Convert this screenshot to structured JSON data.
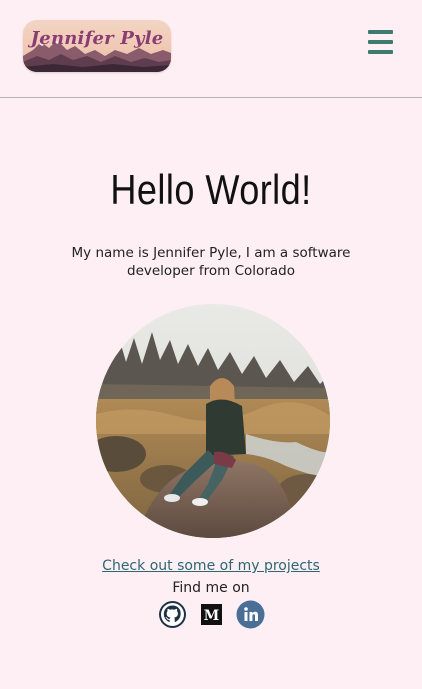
{
  "header": {
    "logo_text": "Jennifer Pyle",
    "menu_icon": "hamburger-menu-icon"
  },
  "hero": {
    "title": "Hello World!",
    "intro": "My name is Jennifer Pyle, I am a software developer from Colorado"
  },
  "links": {
    "projects": "Check out some of my projects",
    "find_me": "Find me on"
  },
  "socials": [
    {
      "name": "GitHub",
      "icon": "github-icon"
    },
    {
      "name": "Medium",
      "icon": "medium-icon"
    },
    {
      "name": "LinkedIn",
      "icon": "linkedin-icon"
    }
  ],
  "colors": {
    "background": "#fdeff3",
    "accent": "#3f7a6f",
    "link": "#2f6670",
    "logo_text": "#8a3d72"
  }
}
